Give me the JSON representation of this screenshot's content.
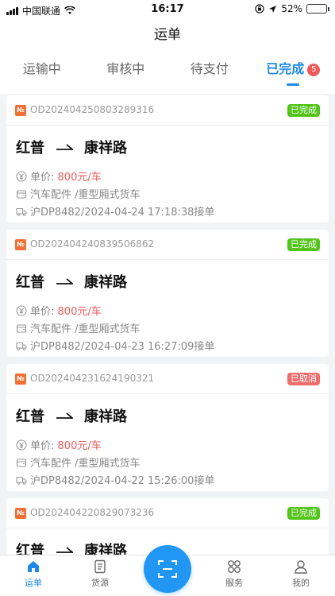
{
  "status_bar": {
    "carrier": "中国联通",
    "time": "16:17",
    "battery": "52%",
    "battery_level": 0.52
  },
  "nav": {
    "title": "运单"
  },
  "tabs": [
    {
      "label": "运输中"
    },
    {
      "label": "审核中"
    },
    {
      "label": "待支付"
    },
    {
      "label": "已完成",
      "badge": "5",
      "active": true
    }
  ],
  "orders": [
    {
      "no_icon": "№",
      "order_no": "OD202404250803289316",
      "status": "已完成",
      "from": "红普",
      "to": "康祥路",
      "price_label": "单价:",
      "price": "800元/车",
      "cargo": "汽车配件 /重型厢式货车",
      "vehicle": "沪DP8482/2024-04-24 17:18:38接单"
    },
    {
      "no_icon": "№",
      "order_no": "OD202404240839506862",
      "status": "已完成",
      "from": "红普",
      "to": "康祥路",
      "price_label": "单价:",
      "price": "800元/车",
      "cargo": "汽车配件 /重型厢式货车",
      "vehicle": "沪DP8482/2024-04-23 16:27:09接单"
    },
    {
      "no_icon": "№",
      "order_no": "OD202404231624190321",
      "status": "已取消",
      "from": "红普",
      "to": "康祥路",
      "price_label": "单价:",
      "price": "800元/车",
      "cargo": "汽车配件 /重型厢式货车",
      "vehicle": "沪DP8482/2024-04-22 15:26:00接单"
    },
    {
      "no_icon": "№",
      "order_no": "OD202404220829073236",
      "status": "已完成",
      "from": "红普",
      "to": "康祥路"
    }
  ],
  "tabbar": {
    "waybill": "运单",
    "cargo": "货源",
    "service": "服务",
    "mine": "我的"
  },
  "colors": {
    "accent": "#1e88e5",
    "done": "#52c41a",
    "cancel": "#ef6c6c",
    "price": "#ef5a5a"
  }
}
